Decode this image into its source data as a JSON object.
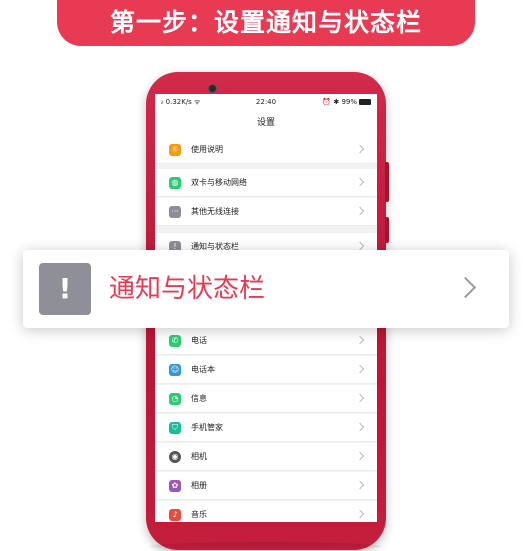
{
  "banner": {
    "text": "第一步：设置通知与状态栏"
  },
  "statusbar": {
    "left": "ᵢₗ 0.32K/s ᯤ",
    "time": "22:40",
    "right": "⏰ ✱ 99%"
  },
  "screen_title": "设置",
  "colors": {
    "accent": "#e83a52",
    "phone": "#c41e3c"
  },
  "settings_rows": [
    {
      "label": "使用说明",
      "icon": "lightbulb-icon",
      "color": "#f39c12",
      "glyph": "☼"
    },
    {
      "label": "双卡与移动网络",
      "icon": "globe-icon",
      "color": "#2ecc71",
      "glyph": "◍"
    },
    {
      "label": "其他无线连接",
      "icon": "more-icon",
      "color": "#8e8e99",
      "glyph": "···"
    },
    {
      "label": "通知与状态栏",
      "icon": "notification-icon",
      "color": "#8e8e99",
      "glyph": "!"
    },
    {
      "label": "电话",
      "icon": "phone-icon",
      "color": "#2ecc71",
      "glyph": "✆"
    },
    {
      "label": "电话本",
      "icon": "contacts-icon",
      "color": "#3498db",
      "glyph": "☺"
    },
    {
      "label": "信息",
      "icon": "message-icon",
      "color": "#2ecc71",
      "glyph": "◔"
    },
    {
      "label": "手机管家",
      "icon": "shield-icon",
      "color": "#1abc9c",
      "glyph": "⛉"
    },
    {
      "label": "相机",
      "icon": "camera-icon",
      "color": "#555555",
      "glyph": "◉"
    },
    {
      "label": "相册",
      "icon": "gallery-icon",
      "color": "#9b59b6",
      "glyph": "✿"
    },
    {
      "label": "音乐",
      "icon": "music-icon",
      "color": "#e74c3c",
      "glyph": "♪"
    }
  ],
  "highlight_card": {
    "label": "通知与状态栏",
    "icon": "notification-icon",
    "glyph": "!"
  }
}
